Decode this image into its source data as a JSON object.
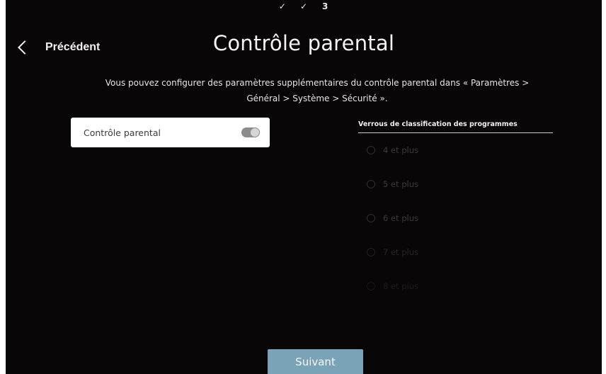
{
  "steps": [
    "✓",
    "✓",
    "3"
  ],
  "header": {
    "back_label": "Précédent",
    "title": "Contrôle parental"
  },
  "description": {
    "line1": "Vous pouvez configurer des paramètres supplémentaires du contrôle parental dans « Paramètres >",
    "line2": "Général > Système > Sécurité »."
  },
  "parental_control": {
    "label": "Contrôle parental",
    "enabled": false
  },
  "ratings": {
    "header": "Verrous de classification des programmes",
    "items": [
      "4 et plus",
      "5 et plus",
      "6 et plus",
      "7 et plus",
      "8 et plus"
    ],
    "enabled": false
  },
  "footer": {
    "next_label": "Suivant"
  }
}
